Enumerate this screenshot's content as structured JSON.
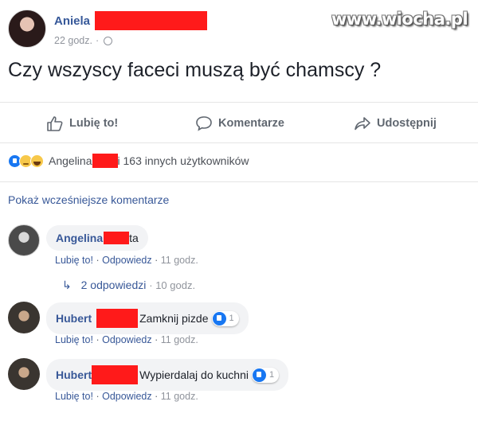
{
  "watermark": "www.wiocha.pl",
  "post": {
    "author": "Aniela",
    "time": "22 godz.",
    "text": "Czy wszyscy faceci muszą być chamscy ?"
  },
  "actions": {
    "like": "Lubię to!",
    "comment": "Komentarze",
    "share": "Udostępnij"
  },
  "reactions": {
    "icons": [
      "like-icon",
      "sad-icon",
      "haha-icon"
    ],
    "name": "Angelina",
    "rest": "i 163 innych użytkowników"
  },
  "more_comments": "Pokaż wcześniejsze komentarze",
  "comments": [
    {
      "author": "Angelina",
      "text": "ta",
      "like": "Lubię to!",
      "reply": "Odpowiedz",
      "time": "11 godz.",
      "replies": {
        "label": "2 odpowiedzi",
        "time": "10 godz."
      }
    },
    {
      "author": "Hubert",
      "text": "Zamknij pizde",
      "like": "Lubię to!",
      "reply": "Odpowiedz",
      "time": "11 godz.",
      "reaction_count": "1"
    },
    {
      "author": "Hubert",
      "text": "Wypierdalaj do kuchni",
      "like": "Lubię to!",
      "reply": "Odpowiedz",
      "time": "11 godz.",
      "reaction_count": "1"
    }
  ],
  "colors": {
    "link": "#385898",
    "redaction": "#ff1a1a",
    "muted": "#90949c",
    "like_blue": "#1877f2"
  }
}
